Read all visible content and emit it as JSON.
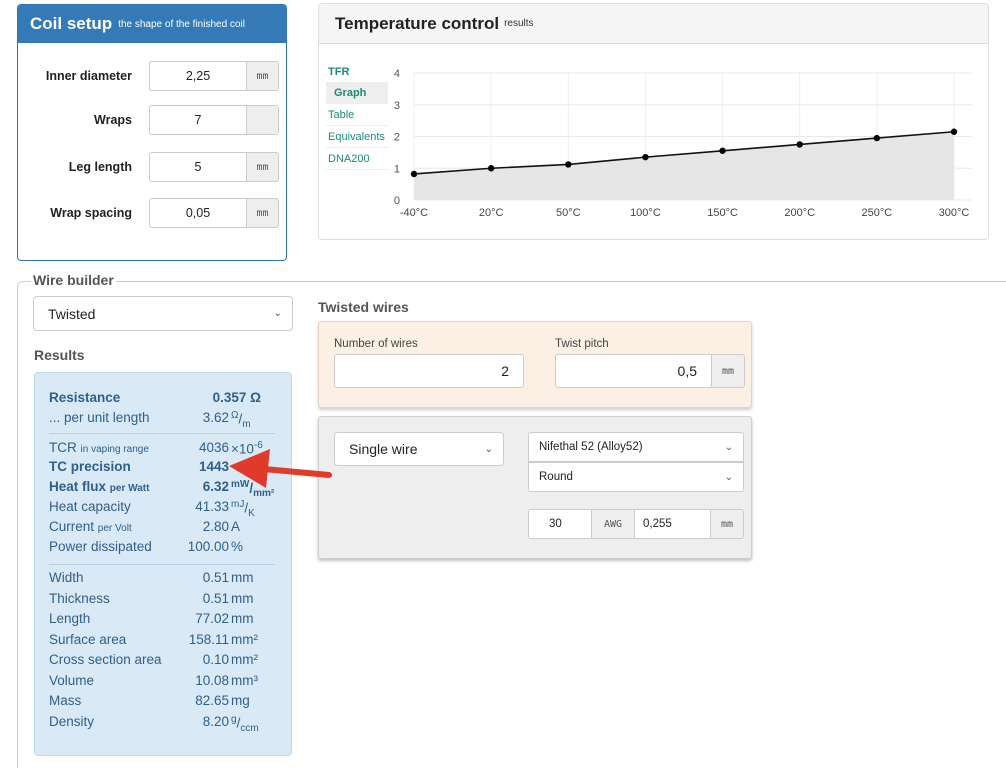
{
  "coil_setup": {
    "title": "Coil setup",
    "subtitle": "the shape of the finished coil",
    "fields": [
      {
        "label": "Inner diameter",
        "value": "2,25",
        "unit": "mm"
      },
      {
        "label": "Wraps",
        "value": "7",
        "unit": ""
      },
      {
        "label": "Leg length",
        "value": "5",
        "unit": "mm"
      },
      {
        "label": "Wrap spacing",
        "value": "0,05",
        "unit": "mm"
      }
    ]
  },
  "temperature_control": {
    "title": "Temperature control",
    "subtitle": "results",
    "tabs": {
      "group": "TFR",
      "items": [
        "Graph",
        "Table",
        "Equivalents",
        "DNA200"
      ],
      "active": "Graph"
    }
  },
  "chart_data": {
    "type": "line",
    "categories": [
      "-40°C",
      "20°C",
      "50°C",
      "100°C",
      "150°C",
      "200°C",
      "250°C",
      "300°C"
    ],
    "values": [
      0.82,
      1.0,
      1.12,
      1.35,
      1.55,
      1.75,
      1.95,
      2.15
    ],
    "yticks": [
      "0",
      "1",
      "2",
      "3",
      "4"
    ],
    "ylim": [
      0,
      4
    ],
    "grid": true,
    "fill_under": true
  },
  "wire_builder": {
    "legend": "Wire builder",
    "type_select": "Twisted",
    "results_title": "Results",
    "results": {
      "resistance": {
        "label": "Resistance",
        "value": "0.357 Ω"
      },
      "per_unit_length": {
        "label": "... per unit length",
        "value": "3.62",
        "unit": "Ω/m"
      },
      "tcr": {
        "label": "TCR",
        "label_small": "in vaping range",
        "value": "4036",
        "unit": "×10⁻⁶"
      },
      "tc_precision": {
        "label": "TC precision",
        "value": "1443"
      },
      "heat_flux": {
        "label": "Heat flux",
        "label_small": "per Watt",
        "value": "6.32",
        "unit": "mW/mm²"
      },
      "heat_capacity": {
        "label": "Heat capacity",
        "value": "41.33",
        "unit": "mJ/K"
      },
      "current": {
        "label": "Current",
        "label_small": "per Volt",
        "value": "2.80",
        "unit": "A"
      },
      "power": {
        "label": "Power dissipated",
        "value": "100.00",
        "unit": "%"
      },
      "width": {
        "label": "Width",
        "value": "0.51",
        "unit": "mm"
      },
      "thickness": {
        "label": "Thickness",
        "value": "0.51",
        "unit": "mm"
      },
      "length": {
        "label": "Length",
        "value": "77.02",
        "unit": "mm"
      },
      "surface_area": {
        "label": "Surface area",
        "value": "158.11",
        "unit": "mm²"
      },
      "cross_section": {
        "label": "Cross section area",
        "value": "0.10",
        "unit": "mm²"
      },
      "volume": {
        "label": "Volume",
        "value": "10.08",
        "unit": "mm³"
      },
      "mass": {
        "label": "Mass",
        "value": "82.65",
        "unit": "mg"
      },
      "density": {
        "label": "Density",
        "value": "8.20",
        "unit": "g/ccm"
      }
    },
    "twisted": {
      "title": "Twisted wires",
      "number_label": "Number of wires",
      "number_value": "2",
      "pitch_label": "Twist pitch",
      "pitch_value": "0,5",
      "pitch_unit": "mm"
    },
    "single_wire": {
      "type_select": "Single wire",
      "material": "Nifethal 52 (Alloy52)",
      "shape": "Round",
      "gauge": "30",
      "gauge_unit": "AWG",
      "diameter": "0,255",
      "diameter_unit": "mm"
    }
  },
  "colors": {
    "primary": "#337ab7",
    "teal": "#1d8a7a",
    "results_bg": "#d9eaf6",
    "arrow": "#e03a2a"
  }
}
